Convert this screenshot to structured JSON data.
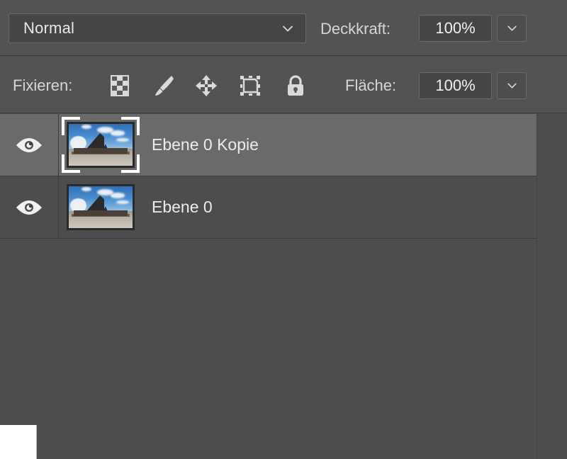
{
  "panel": {
    "name": "layers-panel",
    "background": "#4d4d4d",
    "selected_row_color": "#6a6a6a"
  },
  "blend_row": {
    "blend_mode": {
      "value": "Normal",
      "icon": "chevron-down-icon"
    },
    "opacity": {
      "label": "Deckkraft:",
      "value": "100%",
      "stepper_icon": "chevron-down-icon"
    }
  },
  "lock_row": {
    "label": "Fixieren:",
    "icons": [
      {
        "name": "lock-transparent-pixels-icon",
        "title": "checkerboard"
      },
      {
        "name": "lock-image-pixels-icon",
        "title": "brush"
      },
      {
        "name": "lock-position-icon",
        "title": "move-arrows"
      },
      {
        "name": "lock-artboard-nesting-icon",
        "title": "artboard-frame"
      },
      {
        "name": "lock-all-icon",
        "title": "padlock"
      }
    ],
    "fill": {
      "label": "Fläche:",
      "value": "100%",
      "stepper_icon": "chevron-down-icon"
    }
  },
  "layers": [
    {
      "name": "Ebene 0 Kopie",
      "selected": true,
      "visible": true,
      "visibility_icon": "eye-icon",
      "thumbnail": "photo-wreck-blue-sky"
    },
    {
      "name": "Ebene 0",
      "selected": false,
      "visible": true,
      "visibility_icon": "eye-icon",
      "thumbnail": "photo-wreck-blue-sky"
    }
  ]
}
